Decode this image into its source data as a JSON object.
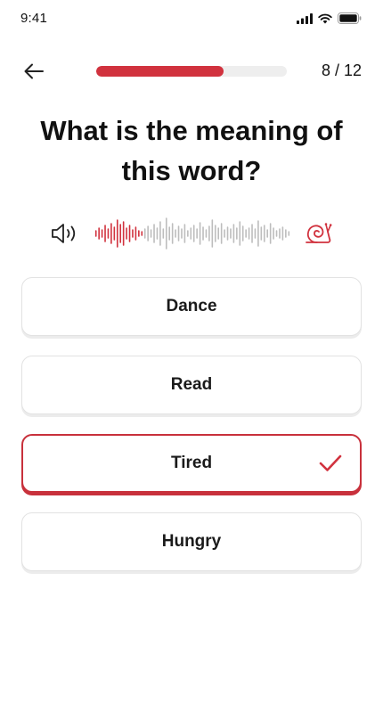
{
  "status_bar": {
    "time": "9:41",
    "icons": [
      "cellular-signal-icon",
      "wifi-icon",
      "battery-icon"
    ]
  },
  "header": {
    "back_icon": "arrow-left-icon",
    "progress_current": 8,
    "progress_total": 12,
    "counter_text": "8 / 12"
  },
  "question": {
    "text": "What is the meaning of this word?"
  },
  "audio": {
    "speaker_icon": "speaker-icon",
    "slow_icon": "snail-icon",
    "played_fraction": 0.25
  },
  "options": [
    {
      "label": "Dance",
      "selected": false
    },
    {
      "label": "Read",
      "selected": false
    },
    {
      "label": "Tired",
      "selected": true
    },
    {
      "label": "Hungry",
      "selected": false
    }
  ],
  "colors": {
    "accent": "#d1323e",
    "track": "#eeeeee",
    "wave_inactive": "#bdbdbd",
    "card_border": "#e2e2e2"
  }
}
